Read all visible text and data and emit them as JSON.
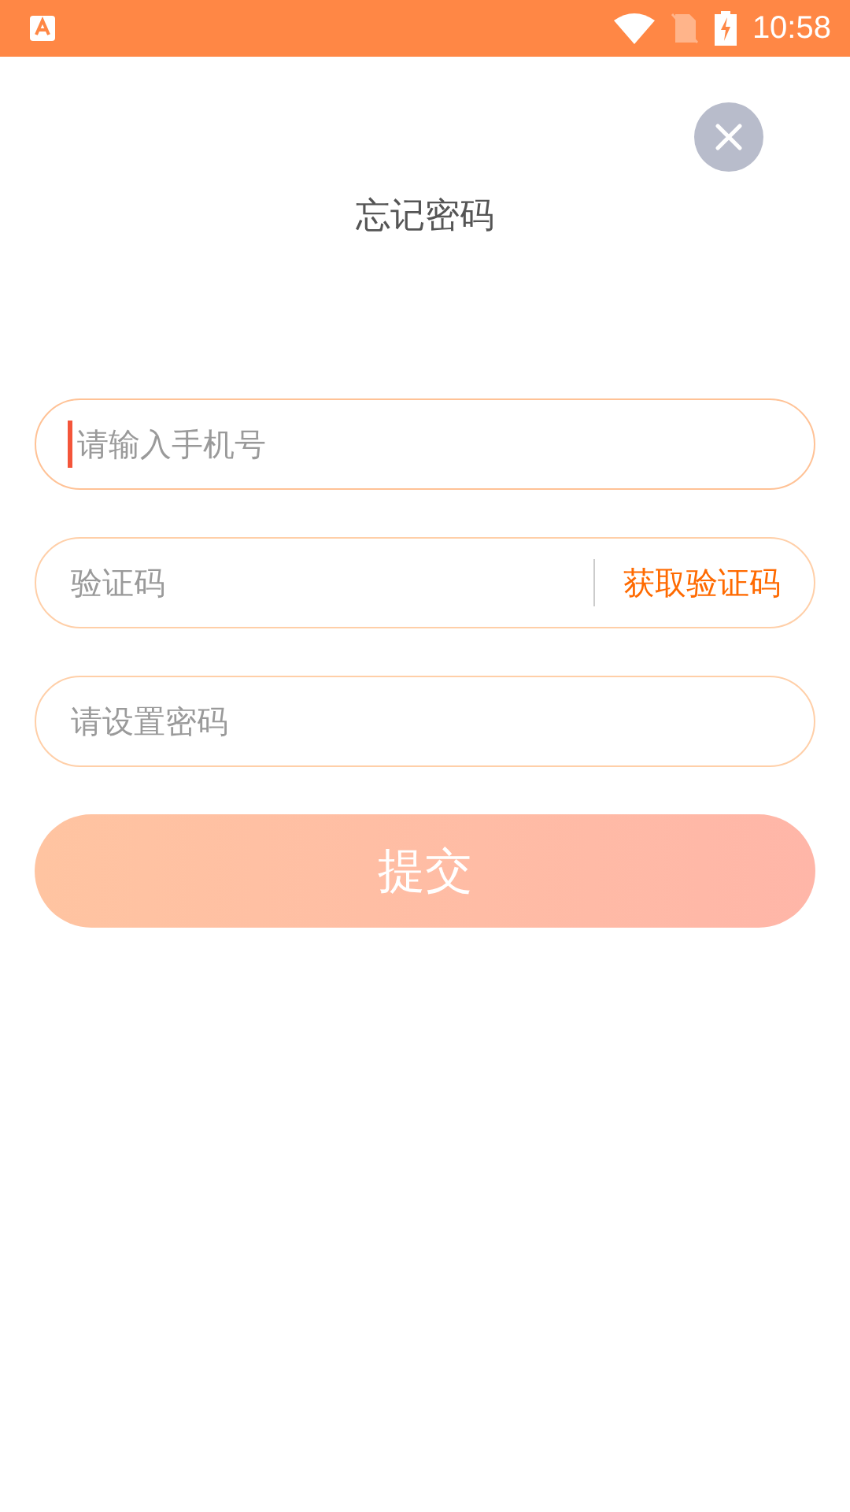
{
  "status_bar": {
    "time": "10:58"
  },
  "title": "忘记密码",
  "fields": [
    {
      "kind": "text",
      "placeholder": "请输入手机号",
      "focused": true
    },
    {
      "kind": "code",
      "placeholder": "验证码",
      "focused": false,
      "action": "获取验证码"
    },
    {
      "kind": "password",
      "placeholder": "请设置密码",
      "focused": false
    }
  ],
  "submit": {
    "label": "提交",
    "disabled": true
  }
}
